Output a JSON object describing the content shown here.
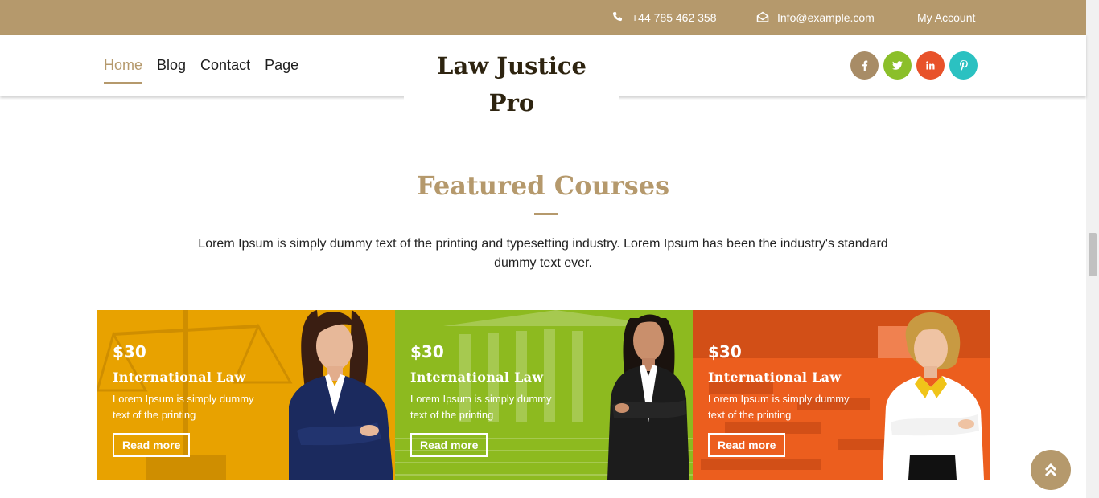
{
  "topbar": {
    "phone": "+44 785 462 358",
    "email": "Info@example.com",
    "account": "My Account"
  },
  "nav": {
    "items": [
      {
        "label": "Home",
        "active": true
      },
      {
        "label": "Blog",
        "active": false
      },
      {
        "label": "Contact",
        "active": false
      },
      {
        "label": "Page",
        "active": false
      }
    ]
  },
  "logo": {
    "text": "Law Justice Pro"
  },
  "social": [
    {
      "icon": "facebook-icon",
      "glyph": "f",
      "color": "#a88c66"
    },
    {
      "icon": "twitter-icon",
      "glyph": "t",
      "color": "#8bbf2a"
    },
    {
      "icon": "linkedin-icon",
      "glyph": "in",
      "color": "#e8522a"
    },
    {
      "icon": "pinterest-icon",
      "glyph": "p",
      "color": "#2bc1c1"
    }
  ],
  "section": {
    "title": "Featured Courses",
    "description": "Lorem Ipsum is simply dummy text of the printing and typesetting industry. Lorem Ipsum has been the industry's standard dummy text ever."
  },
  "cards": [
    {
      "price": "$30",
      "title": "International Law",
      "description": "Lorem Ipsum is simply dummy text of the printing",
      "button": "Read more",
      "color": "#e8a200"
    },
    {
      "price": "$30",
      "title": "International Law",
      "description": "Lorem Ipsum is simply dummy text of the printing",
      "button": "Read more",
      "color": "#8dba1f"
    },
    {
      "price": "$30",
      "title": "International Law",
      "description": "Lorem Ipsum is simply dummy text of the printing",
      "button": "Read more",
      "color": "#ec5e1e"
    }
  ],
  "colors": {
    "accent": "#b5996c",
    "heading_dark": "#2e2410"
  }
}
